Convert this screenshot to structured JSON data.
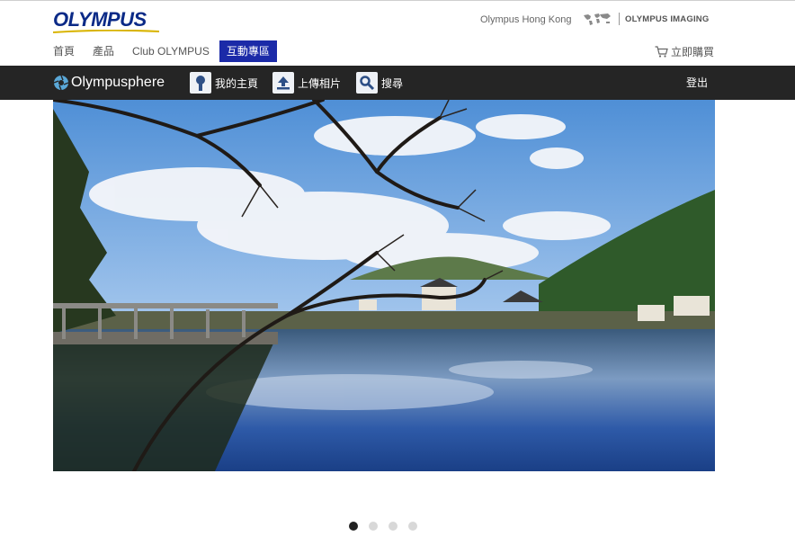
{
  "brand": {
    "logo_text": "OLYMPUS"
  },
  "header": {
    "region_label": "Olympus Hong Kong",
    "imaging_label": "OLYMPUS IMAGING"
  },
  "main_nav": {
    "items": [
      {
        "label": "首頁"
      },
      {
        "label": "產品"
      },
      {
        "label": "Club OLYMPUS"
      },
      {
        "label": "互動專區",
        "active": true
      }
    ],
    "buy_label": "立即購買"
  },
  "sphere_bar": {
    "name": "Olympusphere",
    "items": [
      {
        "label": "我的主頁",
        "icon": "profile-icon"
      },
      {
        "label": "上傳相片",
        "icon": "upload-icon"
      },
      {
        "label": "搜尋",
        "icon": "search-icon"
      }
    ],
    "logout_label": "登出"
  },
  "carousel": {
    "slide_count": 4,
    "active_index": 0
  },
  "colors": {
    "brand_blue": "#0b2a87",
    "nav_active": "#1b2aa8",
    "bar_bg": "#252525",
    "dot_active": "#222222",
    "dot_inactive": "#d8d8d8"
  }
}
